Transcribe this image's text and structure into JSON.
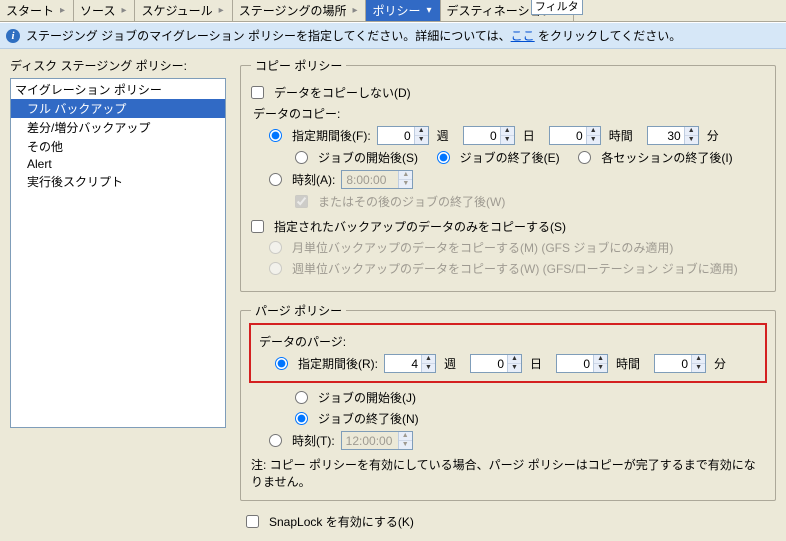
{
  "tabs": {
    "start": "スタート",
    "source": "ソース",
    "schedule": "スケジュール",
    "staging": "ステージングの場所",
    "policy": "ポリシー",
    "destination": "デスティネーション",
    "filter_label": "フィルタ"
  },
  "info": {
    "text_before": "ステージング ジョブのマイグレーション ポリシーを指定してください。詳細については、",
    "link": "ここ",
    "text_after": " をクリックしてください。"
  },
  "left": {
    "title": "ディスク ステージング ポリシー:",
    "items": [
      {
        "label": "マイグレーション ポリシー",
        "indent": false,
        "selected": false
      },
      {
        "label": "フル バックアップ",
        "indent": true,
        "selected": true
      },
      {
        "label": "差分/増分バックアップ",
        "indent": true,
        "selected": false
      },
      {
        "label": "その他",
        "indent": true,
        "selected": false
      },
      {
        "label": "Alert",
        "indent": true,
        "selected": false
      },
      {
        "label": "実行後スクリプト",
        "indent": true,
        "selected": false
      }
    ]
  },
  "copy": {
    "legend": "コピー ポリシー",
    "dont_copy": "データをコピーしない(D)",
    "data_copy_label": "データのコピー:",
    "after_period": "指定期間後(F):",
    "week": "週",
    "day": "日",
    "hour": "時間",
    "min": "分",
    "vals": {
      "weeks": "0",
      "days": "0",
      "hours": "0",
      "mins": "30"
    },
    "after_job_start": "ジョブの開始後(S)",
    "after_job_end": "ジョブの終了後(E)",
    "after_each_session_end": "各セッションの終了後(I)",
    "at_time": "時刻(A):",
    "time_value": "8:00:00",
    "or_after_job_end": "またはその後のジョブの終了後(W)",
    "only_specified_backup": "指定されたバックアップのデータのみをコピーする(S)",
    "monthly": "月単位バックアップのデータをコピーする(M)  (GFS ジョブにのみ適用)",
    "weekly": "週単位バックアップのデータをコピーする(W)  (GFS/ローテーション ジョブに適用)"
  },
  "purge": {
    "legend": "パージ ポリシー",
    "data_purge_label": "データのパージ:",
    "after_period": "指定期間後(R):",
    "vals": {
      "weeks": "4",
      "days": "0",
      "hours": "0",
      "mins": "0"
    },
    "week": "週",
    "day": "日",
    "hour": "時間",
    "min": "分",
    "after_job_start": "ジョブの開始後(J)",
    "after_job_end": "ジョブの終了後(N)",
    "at_time": "時刻(T):",
    "time_value": "12:00:00",
    "note": "注: コピー ポリシーを有効にしている場合、パージ ポリシーはコピーが完了するまで有効になりません。"
  },
  "snaplock": {
    "label": "SnapLock を有効にする(K)"
  }
}
